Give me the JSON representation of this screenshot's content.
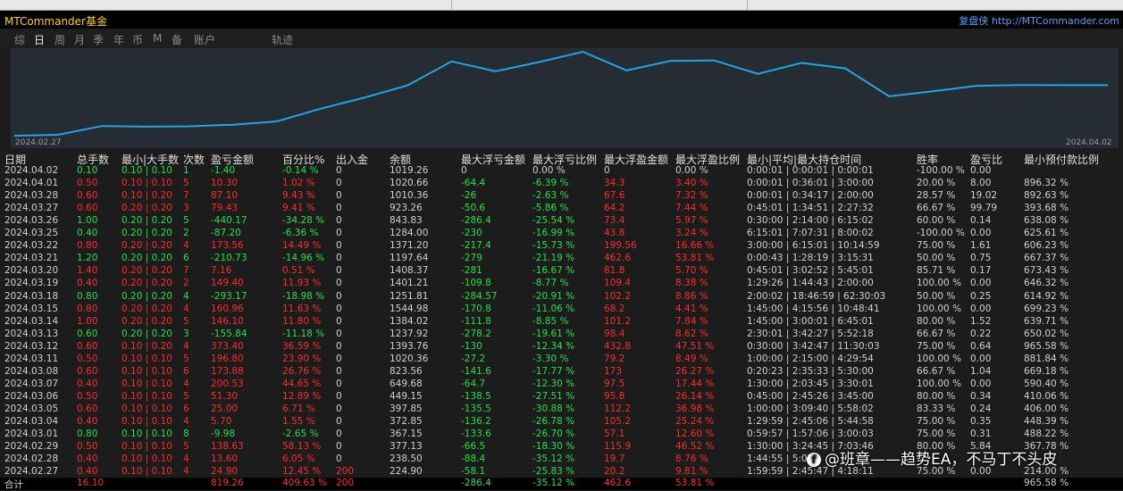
{
  "titlebar": {
    "brand": "MTCommander基金",
    "replay_label": "复盘侠",
    "url": "http://MTCommander.com"
  },
  "tabs": [
    "综",
    "日",
    "周",
    "月",
    "季",
    "年",
    "币",
    "M",
    "备",
    "账户",
    "轨迹"
  ],
  "active_tab": 1,
  "chart_data": {
    "type": "line",
    "x_start_label": "2024.02.27",
    "x_end_label": "2024.04.02",
    "x": [
      "2024.02.27",
      "2024.02.28",
      "2024.02.29",
      "2024.03.01",
      "2024.03.04",
      "2024.03.05",
      "2024.03.06",
      "2024.03.07",
      "2024.03.08",
      "2024.03.11",
      "2024.03.12",
      "2024.03.13",
      "2024.03.14",
      "2024.03.15",
      "2024.03.18",
      "2024.03.19",
      "2024.03.20",
      "2024.03.21",
      "2024.03.22",
      "2024.03.25",
      "2024.03.26",
      "2024.03.27",
      "2024.03.28",
      "2024.03.29",
      "2024.04.01",
      "2024.04.02"
    ],
    "y": [
      224.9,
      238.5,
      377.13,
      367.15,
      372.85,
      397.85,
      449.15,
      649.68,
      823.56,
      1020.36,
      1393.76,
      1237.92,
      1384.02,
      1544.98,
      1251.81,
      1401.21,
      1408.37,
      1197.64,
      1371.2,
      1284.0,
      843.83,
      923.26,
      1010.36,
      1020.66,
      1019.26,
      1019.26
    ],
    "line_color": "#1ea7e6",
    "grid": false
  },
  "columns": [
    "日期",
    "总手数",
    "最小|大手数",
    "次数",
    "盈亏金额",
    "百分比%",
    "出入金",
    "余额",
    "最大浮亏金额",
    "最大浮亏比例",
    "最大浮盈金额",
    "最大浮盈比例",
    "最小|平均|最大持仓时间",
    "胜率",
    "盈亏比",
    "最小预付款比例"
  ],
  "rows": [
    [
      "2024.04.02",
      "0.10",
      "0.10 | 0.10",
      "1",
      "-1.40",
      "-0.14 %",
      "0",
      "1019.26",
      "0",
      "0.00 %",
      "0",
      "0.00 %",
      "0:00:01 | 0:00:01 | 0:00:01",
      "-100.00 %",
      "0.00",
      ""
    ],
    [
      "2024.04.01",
      "0.50",
      "0.10 | 0.10",
      "5",
      "10.30",
      "1.02 %",
      "0",
      "1020.66",
      "-64.4",
      "-6.39 %",
      "34.3",
      "3.40 %",
      "0:00:01 | 0:36:01 | 3:00:00",
      "20.00 %",
      "8.00",
      "896.32 %"
    ],
    [
      "2024.03.28",
      "0.60",
      "0.10 | 0.20",
      "7",
      "87.10",
      "9.43 %",
      "0",
      "1010.36",
      "-26",
      "-2.63 %",
      "67.6",
      "7.32 %",
      "0:00:01 | 0:34:17 | 2:00:00",
      "28.57 %",
      "19.02",
      "892.63 %"
    ],
    [
      "2024.03.27",
      "0.60",
      "0.20 | 0.20",
      "3",
      "79.43",
      "9.41 %",
      "0",
      "923.26",
      "-50.6",
      "-5.86 %",
      "64.2",
      "7.44 %",
      "0:45:01 | 1:34:51 | 2:27:32",
      "66.67 %",
      "99.79",
      "393.68 %"
    ],
    [
      "2024.03.26",
      "1.00",
      "0.20 | 0.20",
      "5",
      "-440.17",
      "-34.28 %",
      "0",
      "843.83",
      "-286.4",
      "-25.54 %",
      "73.4",
      "5.97 %",
      "0:30:00 | 2:14:00 | 6:15:02",
      "60.00 %",
      "0.14",
      "638.08 %"
    ],
    [
      "2024.03.25",
      "0.40",
      "0.20 | 0.20",
      "2",
      "-87.20",
      "-6.36 %",
      "0",
      "1284.00",
      "-230",
      "-16.99 %",
      "43.8",
      "3.24 %",
      "6:15:01 | 7:07:31 | 8:00:02",
      "-100.00 %",
      "0.00",
      "625.61 %"
    ],
    [
      "2024.03.22",
      "0.80",
      "0.20 | 0.20",
      "4",
      "173.56",
      "14.49 %",
      "0",
      "1371.20",
      "-217.4",
      "-15.73 %",
      "199.56",
      "16.66 %",
      "3:00:00 | 6:15:01 | 10:14:59",
      "75.00 %",
      "1.61",
      "606.23 %"
    ],
    [
      "2024.03.21",
      "1.20",
      "0.20 | 0.20",
      "6",
      "-210.73",
      "-14.96 %",
      "0",
      "1197.64",
      "-279",
      "-21.19 %",
      "462.6",
      "53.81 %",
      "0:00:43 | 1:28:19 | 3:15:31",
      "50.00 %",
      "0.75",
      "667.37 %"
    ],
    [
      "2024.03.20",
      "1.40",
      "0.20 | 0.20",
      "7",
      "7.16",
      "0.51 %",
      "0",
      "1408.37",
      "-281",
      "-16.67 %",
      "81.8",
      "5.70 %",
      "0:45:01 | 3:02:52 | 5:45:01",
      "85.71 %",
      "0.17",
      "673.43 %"
    ],
    [
      "2024.03.19",
      "0.40",
      "0.20 | 0.20",
      "2",
      "149.40",
      "11.93 %",
      "0",
      "1401.21",
      "-109.8",
      "-8.77 %",
      "109.4",
      "8.38 %",
      "1:29:26 | 1:44:43 | 2:00:00",
      "100.00 %",
      "0.00",
      "646.32 %"
    ],
    [
      "2024.03.18",
      "0.80",
      "0.20 | 0.20",
      "4",
      "-293.17",
      "-18.98 %",
      "0",
      "1251.81",
      "-284.57",
      "-20.91 %",
      "102.2",
      "8.86 %",
      "2:00:02 | 18:46:59 | 62:30:03",
      "50.00 %",
      "0.25",
      "614.92 %"
    ],
    [
      "2024.03.15",
      "0.80",
      "0.20 | 0.20",
      "4",
      "160.96",
      "11.63 %",
      "0",
      "1544.98",
      "-170.8",
      "-11.06 %",
      "68.2",
      "4.41 %",
      "1:45:00 | 4:15:56 | 10:48:41",
      "100.00 %",
      "0.00",
      "699.23 %"
    ],
    [
      "2024.03.14",
      "1.00",
      "0.20 | 0.20",
      "5",
      "146.10",
      "11.80 %",
      "0",
      "1384.02",
      "-111.8",
      "-8.85 %",
      "101.2",
      "7.84 %",
      "1:45:00 | 3:00:01 | 6:45:01",
      "80.00 %",
      "1.52",
      "639.71 %"
    ],
    [
      "2024.03.13",
      "0.60",
      "0.20 | 0.20",
      "3",
      "-155.84",
      "-11.18 %",
      "0",
      "1237.92",
      "-278.2",
      "-19.61 %",
      "98.4",
      "8.62 %",
      "2:30:01 | 3:42:27 | 5:52:18",
      "66.67 %",
      "0.22",
      "650.02 %"
    ],
    [
      "2024.03.12",
      "0.60",
      "0.10 | 0.20",
      "4",
      "373.40",
      "36.59 %",
      "0",
      "1393.76",
      "-130",
      "-12.34 %",
      "432.8",
      "47.51 %",
      "0:30:00 | 3:42:47 | 11:30:03",
      "75.00 %",
      "0.64",
      "965.58 %"
    ],
    [
      "2024.03.11",
      "0.50",
      "0.10 | 0.10",
      "5",
      "196.80",
      "23.90 %",
      "0",
      "1020.36",
      "-27.2",
      "-3.30 %",
      "79.2",
      "8.49 %",
      "1:00:00 | 2:15:00 | 4:29:54",
      "100.00 %",
      "0.00",
      "881.84 %"
    ],
    [
      "2024.03.08",
      "0.60",
      "0.10 | 0.10",
      "6",
      "173.88",
      "26.76 %",
      "0",
      "823.56",
      "-141.6",
      "-17.77 %",
      "173",
      "26.27 %",
      "0:20:23 | 2:35:33 | 5:30:00",
      "66.67 %",
      "1.04",
      "669.18 %"
    ],
    [
      "2024.03.07",
      "0.40",
      "0.10 | 0.10",
      "4",
      "200.53",
      "44.65 %",
      "0",
      "649.68",
      "-64.7",
      "-12.30 %",
      "97.5",
      "17.44 %",
      "1:30:00 | 2:03:45 | 3:30:01",
      "100.00 %",
      "0.00",
      "590.40 %"
    ],
    [
      "2024.03.06",
      "0.50",
      "0.10 | 0.10",
      "5",
      "51.30",
      "12.89 %",
      "0",
      "449.15",
      "-138.5",
      "-27.51 %",
      "95.8",
      "26.14 %",
      "0:45:00 | 2:45:26 | 3:45:00",
      "80.00 %",
      "0.34",
      "410.06 %"
    ],
    [
      "2024.03.05",
      "0.60",
      "0.10 | 0.10",
      "6",
      "25.00",
      "6.71 %",
      "0",
      "397.85",
      "-135.5",
      "-30.88 %",
      "112.2",
      "36.98 %",
      "1:00:00 | 3:09:40 | 5:58:02",
      "83.33 %",
      "0.24",
      "406.00 %"
    ],
    [
      "2024.03.04",
      "0.40",
      "0.10 | 0.10",
      "4",
      "5.70",
      "1.55 %",
      "0",
      "372.85",
      "-136.2",
      "-26.78 %",
      "105.2",
      "25.24 %",
      "1:29:59 | 2:45:06 | 5:44:58",
      "75.00 %",
      "0.35",
      "448.39 %"
    ],
    [
      "2024.03.01",
      "0.80",
      "0.10 | 0.10",
      "8",
      "-9.98",
      "-2.65 %",
      "0",
      "367.15",
      "-133.6",
      "-26.70 %",
      "57.1",
      "12.60 %",
      "0:59:57 | 1:57:06 | 3:00:03",
      "75.00 %",
      "0.31",
      "488.22 %"
    ],
    [
      "2024.02.29",
      "0.50",
      "0.10 | 0.10",
      "5",
      "138.63",
      "58.13 %",
      "0",
      "377.13",
      "-66.5",
      "-18.30 %",
      "115.9",
      "46.52 %",
      "1:30:00 | 3:24:45 | 7:03:46",
      "80.00 %",
      "5.84",
      "367.78 %"
    ],
    [
      "2024.02.28",
      "0.40",
      "0.10 | 0.10",
      "4",
      "13.60",
      "6.05 %",
      "0",
      "238.50",
      "-88.4",
      "-35.12 %",
      "19.7",
      "8.76 %",
      "1:44:55 | 5:07",
      "",
      "",
      ""
    ],
    [
      "2024.02.27",
      "0.40",
      "0.10 | 0.10",
      "4",
      "24.90",
      "12.45 %",
      "200",
      "224.90",
      "-58.1",
      "-25.83 %",
      "20.2",
      "9.81 %",
      "1:59:59 | 2:45:47 | 4:18:11",
      "75.00 %",
      "0.00",
      "214.00 %"
    ]
  ],
  "total": {
    "label": "合计",
    "lots": "16.10",
    "pnl": "819.26",
    "pct": "409.63 %",
    "deposit": "200",
    "max_float_loss": "-286.4",
    "max_float_loss_pct": "-35.12 %",
    "max_float_profit": "462.6",
    "max_float_profit_pct": "53.81 %",
    "min_margin": "965.58 %"
  },
  "watermark": {
    "icon": "f",
    "text": "@班章——趋势EA，不马丁不头皮"
  },
  "colors": {
    "profit": "#ff2a2a",
    "loss": "#22e04a",
    "neutral": "#d0d0d0",
    "total": "#ffee00",
    "curve": "#1ea7e6"
  }
}
